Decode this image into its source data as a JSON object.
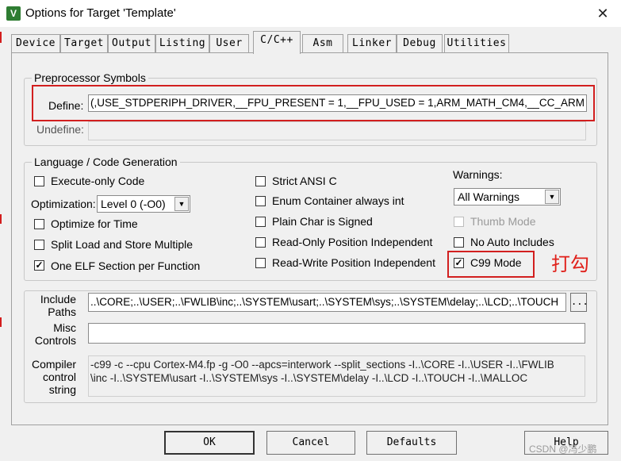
{
  "window": {
    "title": "Options for Target 'Template'",
    "close_glyph": "✕",
    "app_icon": "keil-uvision-icon",
    "app_icon_glyph": "V"
  },
  "tabs": [
    {
      "label": "Device",
      "active": false
    },
    {
      "label": "Target",
      "active": false
    },
    {
      "label": "Output",
      "active": false
    },
    {
      "label": "Listing",
      "active": false
    },
    {
      "label": "User",
      "active": false
    },
    {
      "label": "C/C++",
      "active": true
    },
    {
      "label": "Asm",
      "active": false
    },
    {
      "label": "Linker",
      "active": false
    },
    {
      "label": "Debug",
      "active": false
    },
    {
      "label": "Utilities",
      "active": false
    }
  ],
  "preprocessor": {
    "group_label": "Preprocessor Symbols",
    "define_label": "Define:",
    "define_value": "(,USE_STDPERIPH_DRIVER,__FPU_PRESENT = 1,__FPU_USED = 1,ARM_MATH_CM4,__CC_ARM",
    "undefine_label": "Undefine:",
    "undefine_value": ""
  },
  "language": {
    "group_label": "Language / Code Generation",
    "execute_only": {
      "label": "Execute-only Code",
      "checked": false
    },
    "optimization_label": "Optimization:",
    "optimization_value": "Level 0 (-O0)",
    "optimize_for_time": {
      "label": "Optimize for Time",
      "checked": false
    },
    "split_load_store": {
      "label": "Split Load and Store Multiple",
      "checked": false
    },
    "one_elf_section": {
      "label": "One ELF Section per Function",
      "checked": true
    },
    "strict_ansi": {
      "label": "Strict ANSI C",
      "checked": false
    },
    "enum_container": {
      "label": "Enum Container always int",
      "checked": false
    },
    "plain_char_signed": {
      "label": "Plain Char is Signed",
      "checked": false
    },
    "ro_position_independent": {
      "label": "Read-Only Position Independent",
      "checked": false
    },
    "rw_position_independent": {
      "label": "Read-Write Position Independent",
      "checked": false
    },
    "warnings_label": "Warnings:",
    "warnings_value": "All Warnings",
    "thumb_mode": {
      "label": "Thumb Mode",
      "checked": false,
      "disabled": true
    },
    "no_auto_includes": {
      "label": "No Auto Includes",
      "checked": false
    },
    "c99_mode": {
      "label": "C99 Mode",
      "checked": true
    }
  },
  "paths": {
    "include_label_line1": "Include",
    "include_label_line2": "Paths",
    "include_value": "..\\CORE;..\\USER;..\\FWLIB\\inc;..\\SYSTEM\\usart;..\\SYSTEM\\sys;..\\SYSTEM\\delay;..\\LCD;..\\TOUCH",
    "browse_label": "...",
    "misc_label_line1": "Misc",
    "misc_label_line2": "Controls",
    "misc_value": "",
    "compiler_label_line1": "Compiler",
    "compiler_label_line2": "control",
    "compiler_label_line3": "string",
    "compiler_line1": "-c99 -c --cpu Cortex-M4.fp -g -O0 --apcs=interwork --split_sections -I..\\CORE -I..\\USER -I..\\FWLIB",
    "compiler_line2": "\\inc -I..\\SYSTEM\\usart -I..\\SYSTEM\\sys -I..\\SYSTEM\\delay -I..\\LCD -I..\\TOUCH -I..\\MALLOC"
  },
  "buttons": {
    "ok": "OK",
    "cancel": "Cancel",
    "defaults": "Defaults",
    "help": "Help"
  },
  "annotation": "打勾",
  "watermark": "CSDN @冯少鹏",
  "colors": {
    "highlight_red": "#d21f1f",
    "annotation_red": "#e0201a",
    "dialog_bg": "#f0f0f0"
  }
}
